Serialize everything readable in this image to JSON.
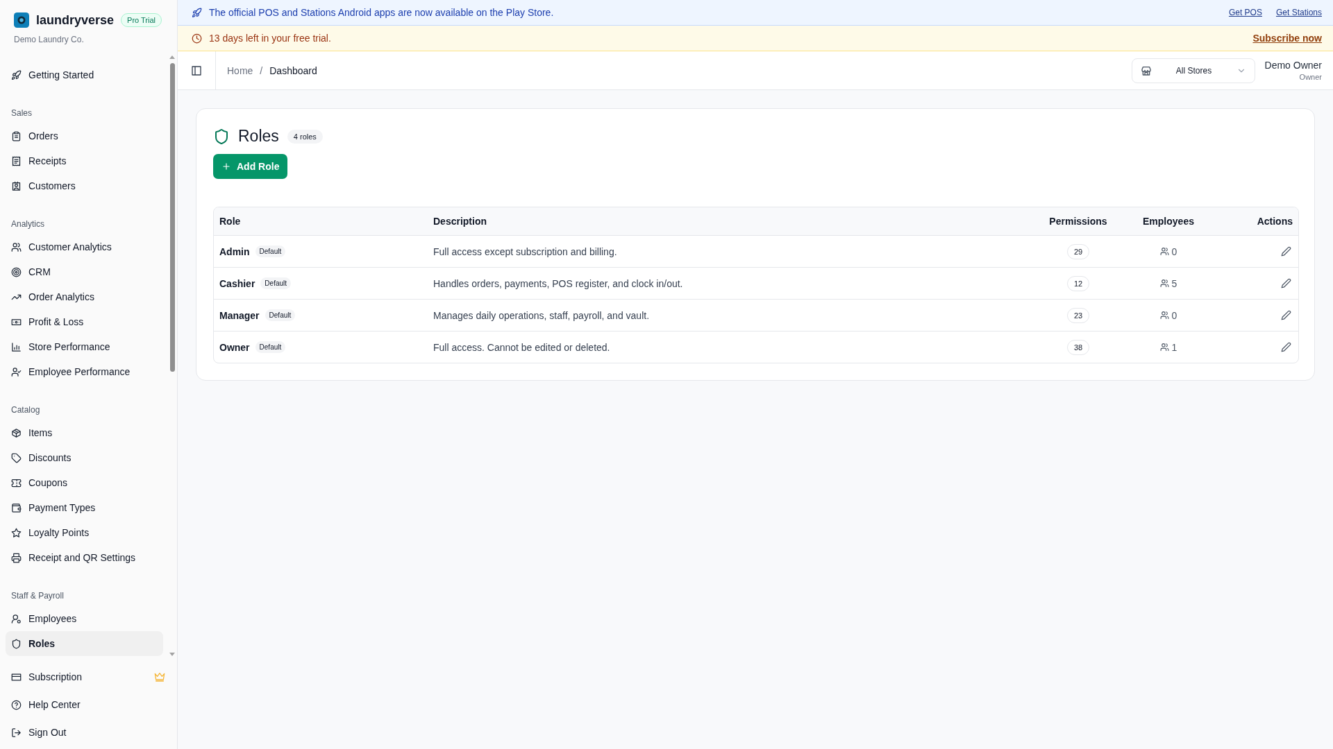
{
  "sidebar": {
    "brand": "laundryverse",
    "badge": "Pro Trial",
    "org": "Demo Laundry Co.",
    "nav": [
      {
        "items": [
          {
            "label": "Getting Started",
            "selected": false
          }
        ]
      },
      {
        "title": "Sales",
        "items": [
          {
            "label": "Orders",
            "selected": false
          },
          {
            "label": "Receipts",
            "selected": false
          },
          {
            "label": "Customers",
            "selected": false
          }
        ]
      },
      {
        "title": "Analytics",
        "items": [
          {
            "label": "Customer Analytics",
            "selected": false
          },
          {
            "label": "CRM",
            "selected": false
          },
          {
            "label": "Order Analytics",
            "selected": false
          },
          {
            "label": "Profit & Loss",
            "selected": false
          },
          {
            "label": "Store Performance",
            "selected": false
          },
          {
            "label": "Employee Performance",
            "selected": false
          }
        ]
      },
      {
        "title": "Catalog",
        "items": [
          {
            "label": "Items",
            "selected": false
          },
          {
            "label": "Discounts",
            "selected": false
          },
          {
            "label": "Coupons",
            "selected": false
          },
          {
            "label": "Payment Types",
            "selected": false
          },
          {
            "label": "Loyalty Points",
            "selected": false
          },
          {
            "label": "Receipt and QR Settings",
            "selected": false
          }
        ]
      },
      {
        "title": "Staff & Payroll",
        "items": [
          {
            "label": "Employees",
            "selected": false
          },
          {
            "label": "Roles",
            "selected": true
          }
        ]
      }
    ],
    "footer": [
      {
        "label": "Subscription",
        "premium": true
      },
      {
        "label": "Help Center",
        "premium": false
      },
      {
        "label": "Sign Out",
        "premium": false
      }
    ]
  },
  "announcement": {
    "text": "The official POS and Stations Android apps are now available on the Play Store.",
    "links": [
      "Get POS",
      "Get Stations"
    ]
  },
  "trial": {
    "text": "13 days left in your free trial.",
    "link": "Subscribe now"
  },
  "header": {
    "breadcrumb": [
      "Home",
      "Dashboard"
    ],
    "breadcrumb_separator": "/",
    "store_select": "All Stores",
    "user": {
      "name": "Demo Owner",
      "role": "Owner"
    }
  },
  "page": {
    "title": "Roles",
    "count": "4 roles",
    "add_button": "Add Role"
  },
  "table": {
    "columns": [
      "Role",
      "Description",
      "Permissions",
      "Employees",
      "Actions"
    ],
    "rows": [
      {
        "role": "Admin",
        "badge": "Default",
        "description": "Full access except subscription and billing.",
        "permissions": "29",
        "employees": "0"
      },
      {
        "role": "Cashier",
        "badge": "Default",
        "description": "Handles orders, payments, POS register, and clock in/out.",
        "permissions": "12",
        "employees": "5"
      },
      {
        "role": "Manager",
        "badge": "Default",
        "description": "Manages daily operations, staff, payroll, and vault.",
        "permissions": "23",
        "employees": "0"
      },
      {
        "role": "Owner",
        "badge": "Default",
        "description": "Full access. Cannot be edited or deleted.",
        "permissions": "38",
        "employees": "1"
      }
    ]
  }
}
